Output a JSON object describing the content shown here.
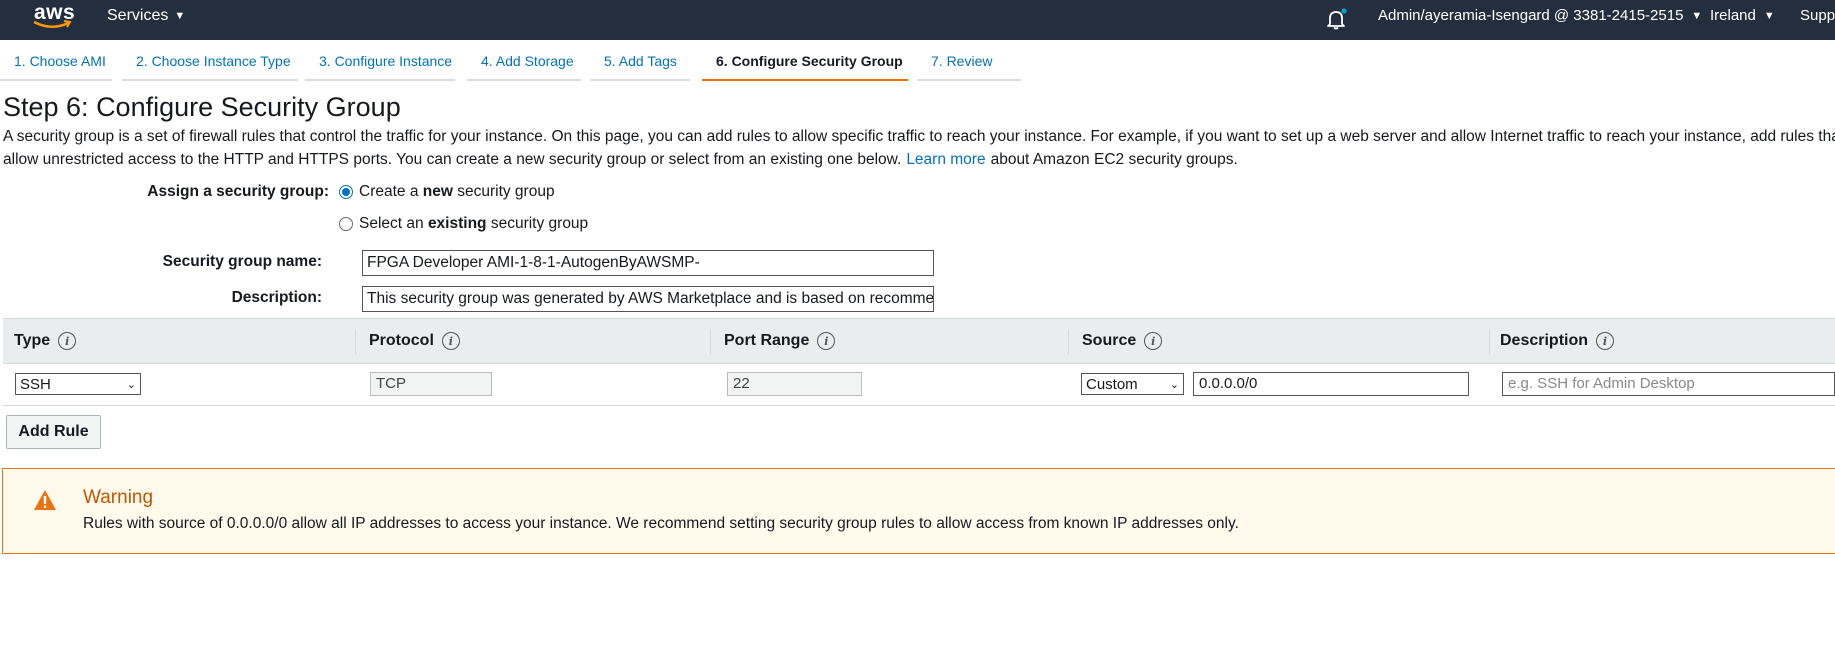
{
  "topbar": {
    "logo_text": "aws",
    "services_label": "Services",
    "account_label": "Admin/ayeramia-Isengard @ 3381-2415-2515",
    "region_label": "Ireland",
    "support_label": "Support",
    "notification_dot_color": "#00a1c9"
  },
  "steps": [
    {
      "label": "1. Choose AMI",
      "active": false
    },
    {
      "label": "2. Choose Instance Type",
      "active": false
    },
    {
      "label": "3. Configure Instance",
      "active": false
    },
    {
      "label": "4. Add Storage",
      "active": false
    },
    {
      "label": "5. Add Tags",
      "active": false
    },
    {
      "label": "6. Configure Security Group",
      "active": true
    },
    {
      "label": "7. Review",
      "active": false
    }
  ],
  "page": {
    "title": "Step 6: Configure Security Group",
    "intro_line1": "A security group is a set of firewall rules that control the traffic for your instance. On this page, you can add rules to allow specific traffic to reach your instance. For example, if you want to set up a web server and allow Internet traffic to reach your instance, add rules that",
    "intro_line2_a": "allow unrestricted access to the HTTP and HTTPS ports. You can create a new security group or select from an existing one below.",
    "learn_more": "Learn more",
    "intro_line2_b": "about Amazon EC2 security groups."
  },
  "assign": {
    "label": "Assign a security group:",
    "option_new_pre": "Create a ",
    "option_new_bold": "new",
    "option_new_post": " security group",
    "option_existing_pre": "Select an ",
    "option_existing_bold": "existing",
    "option_existing_post": " security group",
    "selected": "new"
  },
  "form": {
    "name_label": "Security group name:",
    "name_value": "FPGA Developer AMI-1-8-1-AutogenByAWSMP-",
    "description_label": "Description:",
    "description_value": "This security group was generated by AWS Marketplace and is based on recommended settings"
  },
  "table": {
    "headers": [
      "Type",
      "Protocol",
      "Port Range",
      "Source",
      "Description"
    ],
    "rows": [
      {
        "type": "SSH",
        "protocol": "TCP",
        "port_range": "22",
        "source_mode": "Custom",
        "source_cidr": "0.0.0.0/0",
        "description_placeholder": "e.g. SSH for Admin Desktop"
      }
    ]
  },
  "add_rule_label": "Add Rule",
  "warning": {
    "title": "Warning",
    "text": "Rules with source of 0.0.0.0/0 allow all IP addresses to access your instance. We recommend setting security group rules to allow access from known IP addresses only.",
    "color": "#ec7211"
  },
  "colors": {
    "topbar": "#232f3e",
    "link": "#0073bb",
    "active_tab_underline": "#ec7211"
  }
}
